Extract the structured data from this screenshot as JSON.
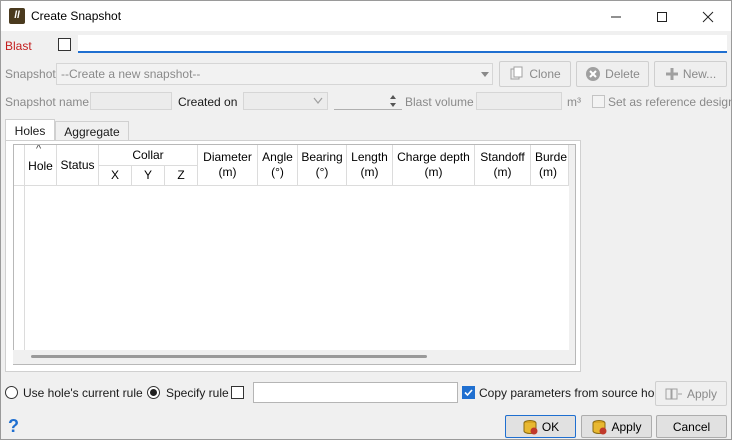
{
  "window": {
    "title": "Create Snapshot"
  },
  "blast": {
    "label": "Blast",
    "input_value": ""
  },
  "snapshot": {
    "label": "Snapshot",
    "select_value": "--Create a new snapshot--",
    "clone_label": "Clone",
    "delete_label": "Delete",
    "new_label": "New..."
  },
  "details": {
    "snapshot_name_label": "Snapshot name",
    "created_on_label": "Created on",
    "blast_volume_label": "Blast volume",
    "volume_unit": "m³",
    "reference_label": "Set as reference design"
  },
  "tabs": [
    {
      "label": "Holes",
      "active": true
    },
    {
      "label": "Aggregate",
      "active": false
    }
  ],
  "table": {
    "sort_indicator": "^",
    "columns": {
      "hole": "Hole",
      "status": "Status",
      "collar": "Collar",
      "x": "X",
      "y": "Y",
      "z": "Z",
      "diameter": "Diameter",
      "diameter_unit": "(m)",
      "angle": "Angle",
      "angle_unit": "(°)",
      "bearing": "Bearing",
      "bearing_unit": "(°)",
      "length": "Length",
      "length_unit": "(m)",
      "charge_depth": "Charge depth",
      "charge_depth_unit": "(m)",
      "standoff": "Standoff",
      "standoff_unit": "(m)",
      "burden": "Burde",
      "burden_unit": "(m)"
    },
    "rows": []
  },
  "rule": {
    "use_current_label": "Use hole's current rule",
    "specify_label": "Specify rule",
    "rule_value": "",
    "copy_params_label": "Copy parameters from source hole",
    "apply_small_label": "Apply"
  },
  "footer": {
    "help_glyph": "?",
    "ok_label": "OK",
    "apply_label": "Apply",
    "cancel_label": "Cancel"
  },
  "colors": {
    "blast_label": "#c41e1e",
    "accent": "#1f6fd0",
    "disabled_text": "#8a8a8a"
  }
}
